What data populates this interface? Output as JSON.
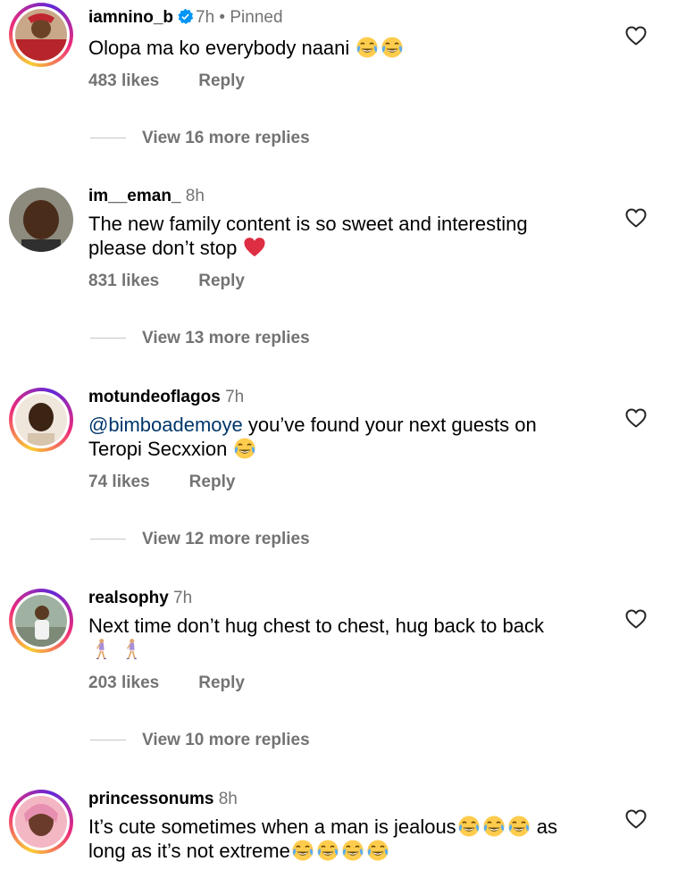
{
  "comments": [
    {
      "username": "iamnino_b",
      "verified": true,
      "time": "7h",
      "pinned": "Pinned",
      "text": "Olopa ma ko everybody naani",
      "emojis": [
        "laugh-cry-emoji",
        "laugh-cry-emoji"
      ],
      "likes": "483 likes",
      "reply": "Reply",
      "more_replies": "View 16 more replies"
    },
    {
      "username": "im__eman_",
      "time": "8h",
      "text_line1": "The new family content is so sweet and interesting",
      "text_line2": "please don’t stop",
      "emojis": [
        "red-heart-emoji"
      ],
      "likes": "831 likes",
      "reply": "Reply",
      "more_replies": "View 13 more replies"
    },
    {
      "username": "motundeoflagos",
      "time": "7h",
      "mention": "@bimboademoye",
      "text_line1": " you’ve found your next guests on",
      "text_line2": "Teropi Secxxion",
      "emojis": [
        "laugh-cry-emoji"
      ],
      "likes": "74 likes",
      "reply": "Reply",
      "more_replies": "View 12 more replies"
    },
    {
      "username": "realsophy",
      "time": "7h",
      "text_line1": "Next time don’t hug chest to chest, hug back to back",
      "emojis": [
        "walking-woman-emoji",
        "walking-woman-emoji"
      ],
      "likes": "203 likes",
      "reply": "Reply",
      "more_replies": "View 10 more replies"
    },
    {
      "username": "princessonums",
      "time": "8h",
      "text_line1a": "It’s cute sometimes when a man is jealous",
      "text_line1b": " as",
      "text_line2": "long as it’s not extreme",
      "emojis_line1": [
        "laugh-cry-emoji",
        "laugh-cry-emoji",
        "laugh-cry-emoji"
      ],
      "emojis_line2": [
        "laugh-cry-emoji",
        "laugh-cry-emoji",
        "laugh-cry-emoji",
        "laugh-cry-emoji"
      ]
    }
  ],
  "icons": {
    "like": "heart-outline-icon",
    "verified": "verified-badge-icon"
  },
  "colors": {
    "secondary_text": "#737373",
    "mention": "#00376b",
    "verified": "#0095f6"
  }
}
